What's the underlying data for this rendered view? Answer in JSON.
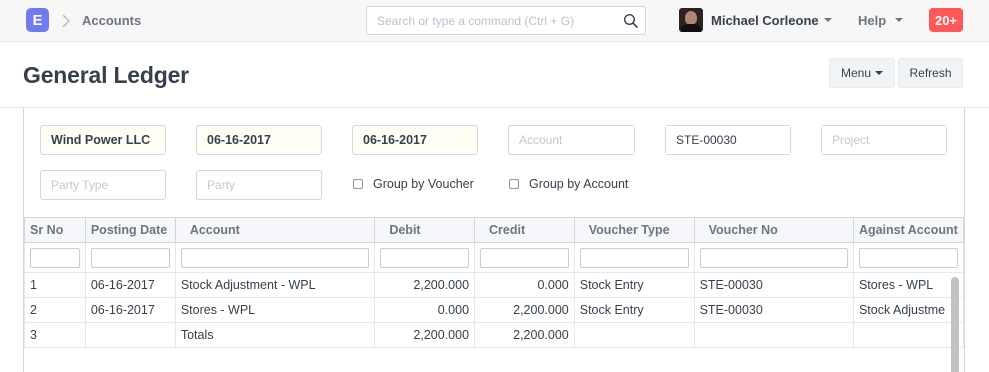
{
  "navbar": {
    "logo_letter": "E",
    "breadcrumb": "Accounts",
    "search_placeholder": "Search or type a command (Ctrl + G)",
    "user_name": "Michael Corleone",
    "help_label": "Help",
    "notification_count": "20+",
    "accent_color": "#6e7cf0",
    "notification_color": "#ff5858"
  },
  "page": {
    "title": "General Ledger",
    "menu_label": "Menu",
    "refresh_label": "Refresh"
  },
  "filters": {
    "company": "Wind Power LLC",
    "from_date": "06-16-2017",
    "to_date": "06-16-2017",
    "account_placeholder": "Account",
    "voucher_no": "STE-00030",
    "project_placeholder": "Project",
    "party_type_placeholder": "Party Type",
    "party_placeholder": "Party",
    "group_by_voucher_label": "Group by Voucher",
    "group_by_account_label": "Group by Account"
  },
  "grid": {
    "columns": [
      "Sr No",
      "Posting Date",
      "Account",
      "Debit",
      "Credit",
      "Voucher Type",
      "Voucher No",
      "Against Account"
    ],
    "rows": [
      [
        "1",
        "06-16-2017",
        "Stock Adjustment - WPL",
        "2,200.000",
        "0.000",
        "Stock Entry",
        "STE-00030",
        "Stores - WPL"
      ],
      [
        "2",
        "06-16-2017",
        "Stores - WPL",
        "0.000",
        "2,200.000",
        "Stock Entry",
        "STE-00030",
        "Stock Adjustme"
      ],
      [
        "3",
        "",
        "Totals",
        "2,200.000",
        "2,200.000",
        "",
        "",
        ""
      ]
    ]
  }
}
